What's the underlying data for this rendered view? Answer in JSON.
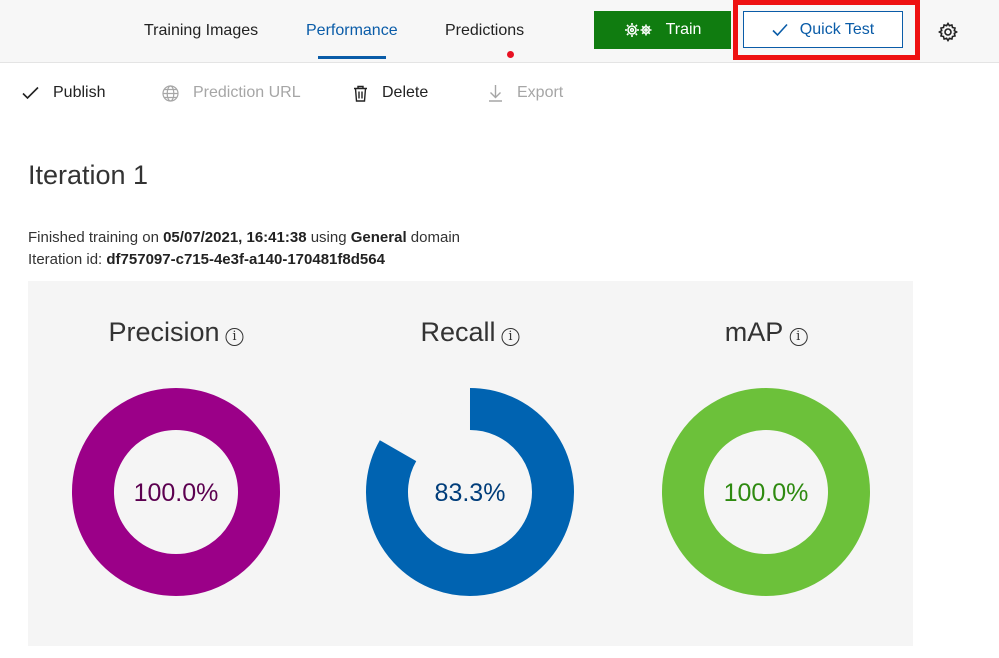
{
  "nav": {
    "tabs": [
      {
        "label": "Training Images"
      },
      {
        "label": "Performance"
      },
      {
        "label": "Predictions"
      }
    ],
    "train_label": "Train",
    "quick_test_label": "Quick Test"
  },
  "toolbar": {
    "publish": "Publish",
    "prediction_url": "Prediction URL",
    "delete": "Delete",
    "export": "Export"
  },
  "iteration": {
    "title": "Iteration 1",
    "finished_prefix": "Finished training on",
    "finished_date": "05/07/2021, 16:41:38",
    "using_text": "using",
    "domain_name": "General",
    "domain_suffix": "domain",
    "id_label": "Iteration id:",
    "id_value": "df757097-c715-4e3f-a140-170481f8d564"
  },
  "metrics": [
    {
      "name": "Precision",
      "display": "100.0%",
      "fraction": 1.0,
      "color": "#9b0088",
      "text_color": "#5c0050"
    },
    {
      "name": "Recall",
      "display": "83.3%",
      "fraction": 0.833,
      "color": "#0063b1",
      "text_color": "#003d7a"
    },
    {
      "name": "mAP",
      "display": "100.0%",
      "fraction": 1.0,
      "color": "#6cc13a",
      "text_color": "#2e8a10"
    }
  ],
  "icons": {
    "train": "gears-icon",
    "quick_test": "checkmark-icon",
    "settings": "gear-icon",
    "publish": "checkmark-icon",
    "prediction_url": "globe-icon",
    "delete": "trash-icon",
    "export": "download-arrow-icon",
    "info": "info-icon"
  },
  "colors": {
    "accent": "#0a5ca8",
    "train_button": "#107c10",
    "highlight": "#ee1111",
    "notification_dot": "#e81123"
  }
}
